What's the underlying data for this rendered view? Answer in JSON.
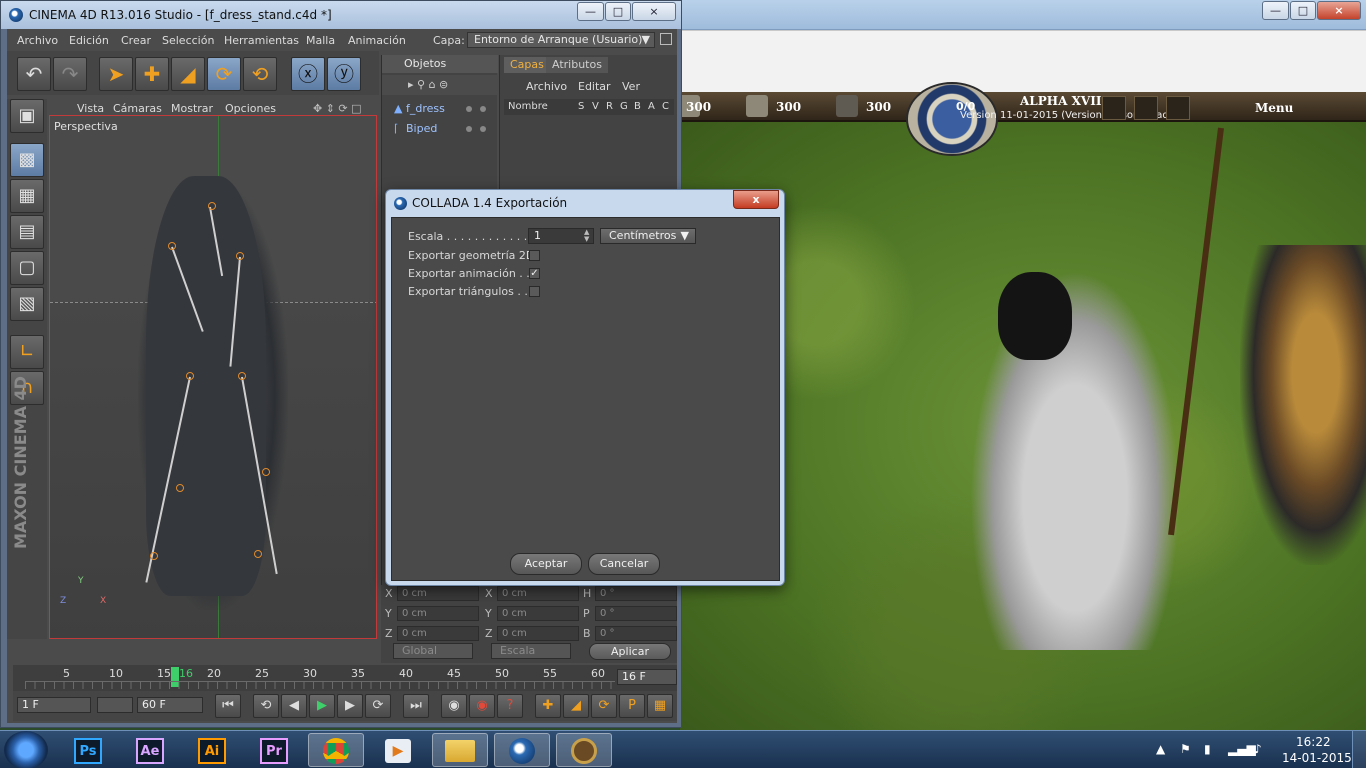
{
  "c4d": {
    "title": "CINEMA 4D R13.016 Studio - [f_dress_stand.c4d *]",
    "menus": [
      "Archivo",
      "Edición",
      "Crear",
      "Selección",
      "Herramientas",
      "Malla",
      "Animación"
    ],
    "capa_label": "Capa:",
    "capa_value": "Entorno de Arranque (Usuario)",
    "viewport_menus": [
      "Vista",
      "Cámaras",
      "Mostrar",
      "Opciones"
    ],
    "viewport_label": "Perspectiva",
    "brand": "MAXON CINEMA 4D",
    "axis_labels": {
      "x": "X",
      "y": "Y",
      "z": "Z"
    }
  },
  "objects": {
    "tab": "Objetos",
    "items": [
      {
        "name": "f_dress"
      },
      {
        "name": "Biped"
      }
    ]
  },
  "layers": {
    "tabs": [
      "Capas",
      "Atributos"
    ],
    "menus": [
      "Archivo",
      "Editar",
      "Ver"
    ],
    "column_name": "Nombre",
    "column_flags": [
      "S",
      "V",
      "R",
      "G",
      "B",
      "A",
      "C"
    ]
  },
  "attributes": {
    "rows": [
      {
        "axis_a": "X",
        "val_a": "0 cm",
        "axis_b": "X",
        "val_b": "0 cm",
        "axis_c": "H",
        "val_c": "0 °"
      },
      {
        "axis_a": "Y",
        "val_a": "0 cm",
        "axis_b": "Y",
        "val_b": "0 cm",
        "axis_c": "P",
        "val_c": "0 °"
      },
      {
        "axis_a": "Z",
        "val_a": "0 cm",
        "axis_b": "Z",
        "val_b": "0 cm",
        "axis_c": "B",
        "val_c": "0 °"
      }
    ],
    "coord_system": "Global",
    "coord_mode": "Escala",
    "apply_label": "Aplicar"
  },
  "timeline": {
    "ticks": [
      "5",
      "10",
      "15",
      "16",
      "20",
      "25",
      "30",
      "35",
      "40",
      "45",
      "50",
      "55",
      "60"
    ],
    "current_frame": "16 F",
    "start_frame": "1 F",
    "end_frame": "60 F"
  },
  "dialog": {
    "title": "COLLADA 1.4 Exportación",
    "close_label": "x",
    "scale_label": "Escala . . . . . . . . . . . . .",
    "scale_value": "1",
    "unit_value": "Centímetros",
    "options": [
      {
        "label": "Exportar geometría 2D",
        "checked": false
      },
      {
        "label": "Exportar animación . .",
        "checked": true
      },
      {
        "label": "Exportar triángulos . .",
        "checked": false
      }
    ],
    "accept_label": "Aceptar",
    "cancel_label": "Cancelar"
  },
  "game": {
    "resources": [
      "300",
      "300",
      "300"
    ],
    "score": "0/0",
    "title": "ALPHA XVII",
    "version": "Version 11-01-2015 (Version personalizada)",
    "menu_label": "Menu"
  },
  "taskbar": {
    "apps": [
      "Ps",
      "Ae",
      "Ai",
      "Pr"
    ],
    "time": "16:22",
    "date": "14-01-2015"
  }
}
